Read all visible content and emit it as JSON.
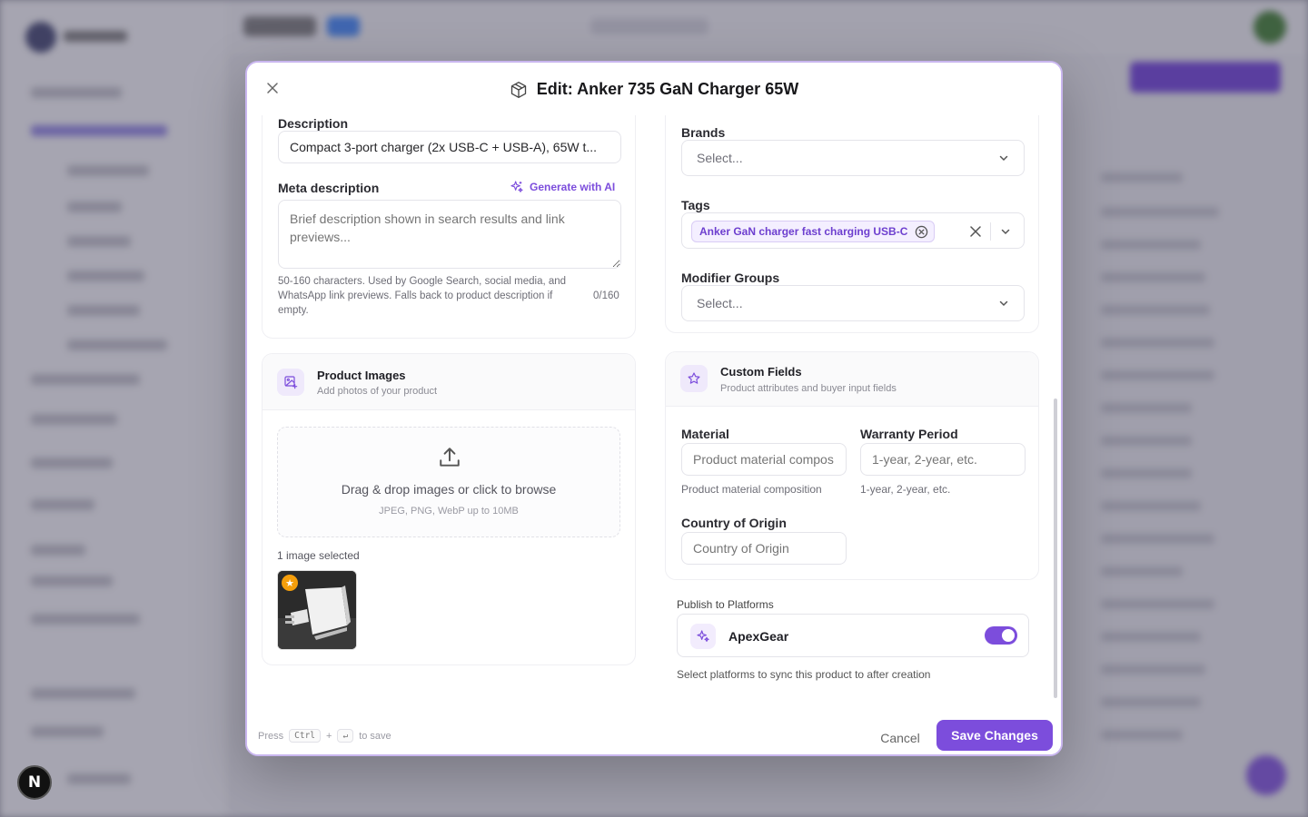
{
  "modal": {
    "title": "Edit: Anker 735 GaN Charger 65W"
  },
  "left": {
    "description": {
      "label": "Description",
      "value": "Compact 3-port charger (2x USB-C + USB-A), 65W t..."
    },
    "meta_description": {
      "label": "Meta description",
      "generate_label": "Generate with AI",
      "placeholder": "Brief description shown in search results and link previews...",
      "hint": "50-160 characters. Used by Google Search, social media, and WhatsApp link previews. Falls back to product description if empty.",
      "counter": "0/160"
    },
    "product_images": {
      "title": "Product Images",
      "subtitle": "Add photos of your product",
      "drop_text": "Drag & drop images or click to browse",
      "drop_formats": "JPEG, PNG, WebP up to 10MB",
      "selected_count": "1 image selected"
    }
  },
  "right": {
    "brands": {
      "label": "Brands",
      "value": "Select..."
    },
    "tags": {
      "label": "Tags",
      "chip": "Anker GaN charger fast charging USB-C"
    },
    "modifier_groups": {
      "label": "Modifier Groups",
      "value": "Select..."
    },
    "custom_fields": {
      "title": "Custom Fields",
      "subtitle": "Product attributes and buyer input fields",
      "material": {
        "label": "Material",
        "placeholder": "Product material compos",
        "hint": "Product material composition"
      },
      "warranty": {
        "label": "Warranty Period",
        "placeholder": "1-year, 2-year, etc.",
        "hint": "1-year, 2-year, etc."
      },
      "origin": {
        "label": "Country of Origin",
        "placeholder": "Country of Origin"
      }
    },
    "publish": {
      "label": "Publish to Platforms",
      "platform_name": "ApexGear",
      "enabled": true,
      "hint": "Select platforms to sync this product to after creation"
    }
  },
  "footer": {
    "press": "Press",
    "key_ctrl": "Ctrl",
    "plus": "+",
    "key_enter": "↵",
    "to_save": "to save",
    "cancel_label": "Cancel",
    "save_label": "Save Changes"
  },
  "colors": {
    "accent": "#7c4ddc",
    "star_badge": "#f59e0b"
  },
  "icons": {
    "close": "close-icon",
    "title": "box-icon",
    "generate": "sparkle-icon",
    "images": "image-plus-icon",
    "upload": "upload-icon",
    "custom_fields": "star-outline-icon",
    "platform": "sparkle-icon",
    "primary_image": "star-icon"
  },
  "badge": {
    "letter": "N"
  }
}
